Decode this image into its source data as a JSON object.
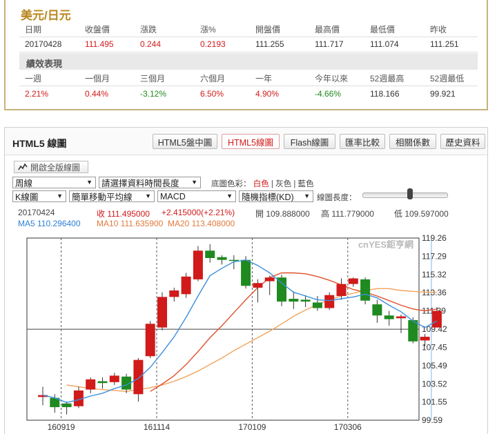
{
  "quote": {
    "title": "美元/日元",
    "headers": [
      "日期",
      "收盤價",
      "漲跌",
      "漲%",
      "開盤價",
      "最高價",
      "最低價",
      "昨收"
    ],
    "values": [
      "20170428",
      "111.495",
      "0.244",
      "0.2193",
      "111.255",
      "111.717",
      "111.074",
      "111.251"
    ],
    "section_title": "績效表現",
    "perf_headers": [
      "一週",
      "一個月",
      "三個月",
      "六個月",
      "一年",
      "今年以來",
      "52週最高",
      "52週最低"
    ],
    "perf_values": [
      "2.21%",
      "0.44%",
      "-3.12%",
      "6.50%",
      "4.90%",
      "-4.66%",
      "118.166",
      "99.921"
    ]
  },
  "panel": {
    "title": "HTML5 線圖",
    "tabs": [
      "HTML5盤中圖",
      "HTML5線圖",
      "Flash線圖",
      "匯率比較",
      "相關係數",
      "歷史資料"
    ],
    "active_tab": 1
  },
  "controls": {
    "fullview_label": "開啟全版線圖",
    "period": "周線",
    "range": "請選擇資料時間長度",
    "bg_label": "底圖色彩：",
    "bg_white": "白色",
    "bg_gray": "灰色",
    "bg_blue": "藍色",
    "sep": "|",
    "kline": "K線圖",
    "ma_type": "簡單移動平均線",
    "indicator1": "MACD",
    "indicator2": "隨機指標(KD)",
    "line_length_label": "線圖長度："
  },
  "info": {
    "date": "20170424",
    "close": "收 111.495000",
    "change": "+2.415000(+2.21%)",
    "open": "開 109.888000",
    "high": "高 111.779000",
    "low": "低 109.597000",
    "ma5": "MA5 110.296400",
    "ma10": "MA10 111.635900",
    "ma20": "MA20 113.408000"
  },
  "chart_data": {
    "type": "candlestick",
    "watermark": "cnYES鉅亨網",
    "y_ticks": [
      "119.26",
      "117.29",
      "115.32",
      "113.36",
      "111.39",
      "109.42",
      "107.45",
      "105.49",
      "103.52",
      "101.55",
      "99.59"
    ],
    "ylim": [
      99.59,
      119.26
    ],
    "x_labels": [
      {
        "label": "160919",
        "index": 2
      },
      {
        "label": "161114",
        "index": 10
      },
      {
        "label": "170109",
        "index": 18
      },
      {
        "label": "170306",
        "index": 26
      }
    ],
    "reference_line": 109.42,
    "candles": [
      {
        "o": 102.1,
        "c": 102.3,
        "h": 103.2,
        "l": 101.2
      },
      {
        "o": 102.0,
        "c": 101.0,
        "h": 102.4,
        "l": 100.4
      },
      {
        "o": 101.4,
        "c": 101.0,
        "h": 101.6,
        "l": 100.2
      },
      {
        "o": 101.1,
        "c": 102.8,
        "h": 103.2,
        "l": 100.9
      },
      {
        "o": 102.9,
        "c": 104.0,
        "h": 104.2,
        "l": 102.5
      },
      {
        "o": 103.8,
        "c": 103.6,
        "h": 104.2,
        "l": 103.0
      },
      {
        "o": 103.7,
        "c": 104.4,
        "h": 104.7,
        "l": 103.4
      },
      {
        "o": 104.3,
        "c": 102.9,
        "h": 104.6,
        "l": 102.5
      },
      {
        "o": 102.4,
        "c": 106.1,
        "h": 106.3,
        "l": 101.6
      },
      {
        "o": 106.5,
        "c": 110.0,
        "h": 110.3,
        "l": 106.3
      },
      {
        "o": 109.6,
        "c": 112.9,
        "h": 113.4,
        "l": 109.3
      },
      {
        "o": 112.9,
        "c": 113.6,
        "h": 113.9,
        "l": 112.4
      },
      {
        "o": 113.2,
        "c": 115.1,
        "h": 115.5,
        "l": 112.8
      },
      {
        "o": 114.8,
        "c": 117.9,
        "h": 118.4,
        "l": 114.6
      },
      {
        "o": 117.9,
        "c": 117.1,
        "h": 118.6,
        "l": 116.6
      },
      {
        "o": 117.2,
        "c": 116.9,
        "h": 117.4,
        "l": 116.4
      },
      {
        "o": 116.9,
        "c": 116.8,
        "h": 117.4,
        "l": 115.9
      },
      {
        "o": 116.9,
        "c": 114.1,
        "h": 117.3,
        "l": 113.8
      },
      {
        "o": 113.9,
        "c": 114.4,
        "h": 114.8,
        "l": 112.3
      },
      {
        "o": 114.6,
        "c": 115.0,
        "h": 115.2,
        "l": 113.1
      },
      {
        "o": 115.0,
        "c": 112.4,
        "h": 115.3,
        "l": 111.9
      },
      {
        "o": 112.7,
        "c": 112.4,
        "h": 113.5,
        "l": 111.6
      },
      {
        "o": 112.6,
        "c": 112.4,
        "h": 113.1,
        "l": 111.8
      },
      {
        "o": 112.3,
        "c": 111.7,
        "h": 113.0,
        "l": 111.4
      },
      {
        "o": 111.7,
        "c": 113.1,
        "h": 113.4,
        "l": 111.5
      },
      {
        "o": 113.0,
        "c": 114.3,
        "h": 114.9,
        "l": 112.6
      },
      {
        "o": 114.3,
        "c": 114.9,
        "h": 115.0,
        "l": 114.0
      },
      {
        "o": 114.8,
        "c": 112.5,
        "h": 115.0,
        "l": 112.1
      },
      {
        "o": 112.1,
        "c": 110.9,
        "h": 112.6,
        "l": 110.1
      },
      {
        "o": 110.9,
        "c": 110.5,
        "h": 111.4,
        "l": 109.8
      },
      {
        "o": 110.6,
        "c": 110.8,
        "h": 111.0,
        "l": 109.0
      },
      {
        "o": 110.4,
        "c": 108.1,
        "h": 110.7,
        "l": 107.9
      },
      {
        "o": 108.2,
        "c": 108.6,
        "h": 108.9,
        "l": 107.6
      },
      {
        "o": 109.6,
        "c": 111.4,
        "h": 111.8,
        "l": 109.6
      }
    ],
    "ma5": [
      102.3,
      102.0,
      101.5,
      101.8,
      102.2,
      102.5,
      103.0,
      103.4,
      104.1,
      105.3,
      106.9,
      108.6,
      110.7,
      113.0,
      115.2,
      116.0,
      116.7,
      116.9,
      116.3,
      115.5,
      114.4,
      113.4,
      113.0,
      112.6,
      112.5,
      112.7,
      112.9,
      113.2,
      112.8,
      112.0,
      111.3,
      110.3,
      109.6,
      110.3
    ],
    "ma10": [
      null,
      null,
      null,
      null,
      null,
      null,
      null,
      null,
      null,
      102.7,
      103.5,
      104.4,
      105.6,
      107.0,
      108.5,
      109.8,
      111.2,
      112.6,
      113.9,
      115.0,
      115.5,
      115.5,
      115.4,
      115.1,
      114.7,
      114.2,
      113.7,
      113.4,
      113.0,
      112.5,
      112.0,
      111.6,
      111.4,
      111.6
    ],
    "ma20": [
      null,
      null,
      103.4,
      103.2,
      103.0,
      102.9,
      102.8,
      102.7,
      102.9,
      103.1,
      103.4,
      103.8,
      104.3,
      104.9,
      105.6,
      106.3,
      107.1,
      107.8,
      108.5,
      109.2,
      110.0,
      110.8,
      111.5,
      112.1,
      112.6,
      113.0,
      113.3,
      113.6,
      113.8,
      113.8,
      113.6,
      113.5,
      113.4,
      113.4
    ]
  },
  "colors": {
    "up": "#d11a1a",
    "down": "#1f8a1f",
    "ma5": "#3b8fdc",
    "ma10": "#e0502a",
    "ma20": "#f2a35a",
    "gold": "#c8b27a"
  }
}
